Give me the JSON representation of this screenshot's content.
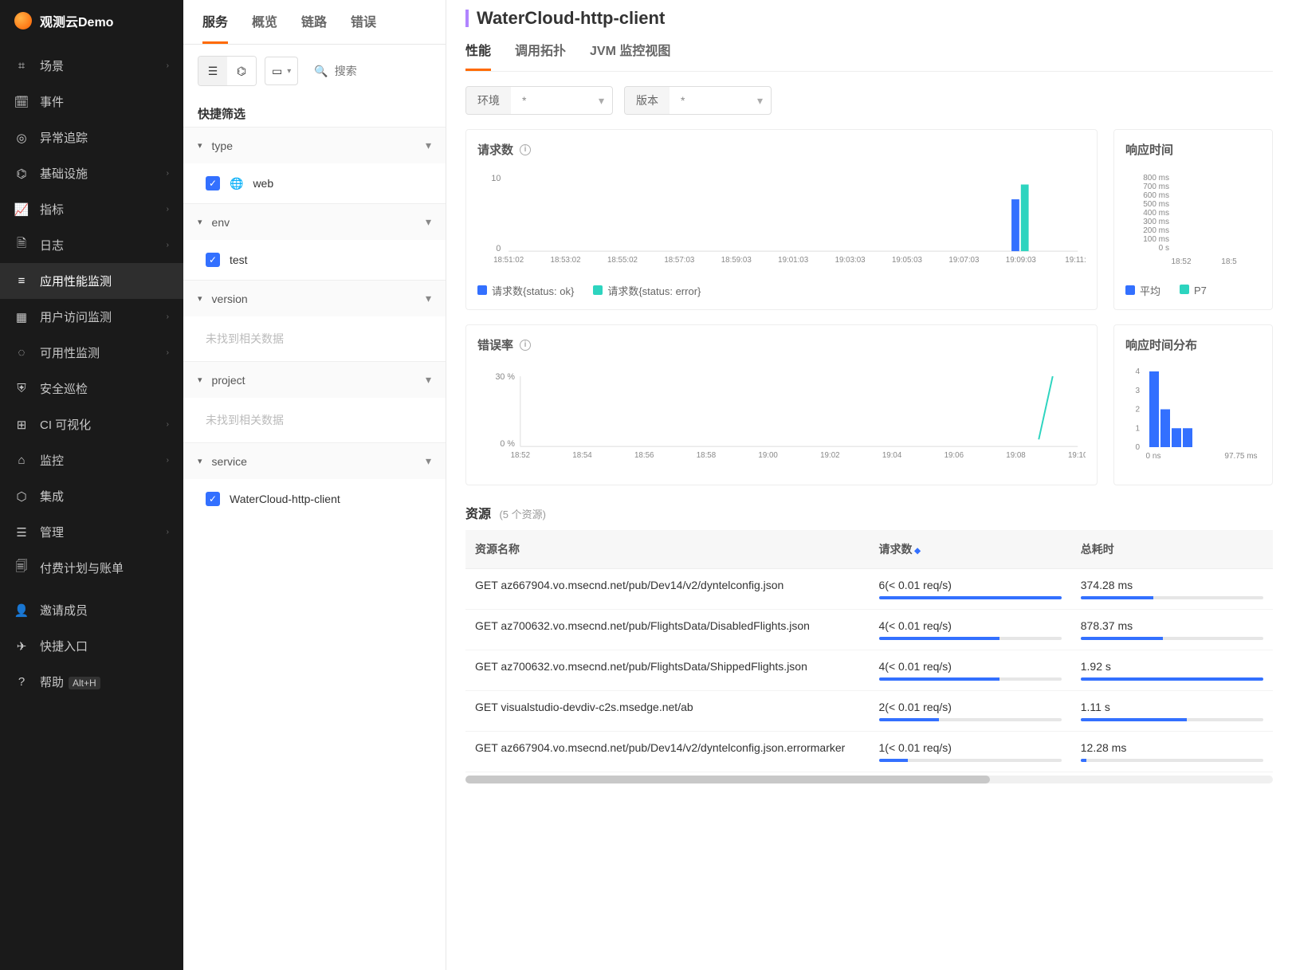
{
  "brand": "观测云Demo",
  "sidebar": {
    "items": [
      {
        "icon": "⌗",
        "label": "场景",
        "chev": true
      },
      {
        "icon": "🗓",
        "label": "事件"
      },
      {
        "icon": "◎",
        "label": "异常追踪"
      },
      {
        "icon": "⌬",
        "label": "基础设施",
        "chev": true
      },
      {
        "icon": "📈",
        "label": "指标",
        "chev": true
      },
      {
        "icon": "🗎",
        "label": "日志",
        "chev": true
      },
      {
        "icon": "≡",
        "label": "应用性能监测",
        "active": true
      },
      {
        "icon": "▦",
        "label": "用户访问监测",
        "chev": true
      },
      {
        "icon": "◌",
        "label": "可用性监测",
        "chev": true
      },
      {
        "icon": "⛨",
        "label": "安全巡检"
      },
      {
        "icon": "⊞",
        "label": "CI 可视化",
        "chev": true
      },
      {
        "icon": "⌂",
        "label": "监控",
        "chev": true
      },
      {
        "icon": "⬡",
        "label": "集成"
      },
      {
        "icon": "☰",
        "label": "管理",
        "chev": true
      },
      {
        "icon": "🗐",
        "label": "付费计划与账单"
      }
    ],
    "bottom": [
      {
        "icon": "👤",
        "label": "邀请成员"
      },
      {
        "icon": "✈",
        "label": "快捷入口"
      },
      {
        "icon": "?",
        "label": "帮助",
        "shortcut": "Alt+H"
      }
    ]
  },
  "topTabs": [
    "服务",
    "概览",
    "链路",
    "错误"
  ],
  "activeTopTab": 0,
  "search": {
    "placeholder": "搜索"
  },
  "filterTitle": "快捷筛选",
  "filterGroups": [
    {
      "name": "type",
      "items": [
        {
          "icon": "🌐",
          "label": "web",
          "checked": true
        }
      ]
    },
    {
      "name": "env",
      "items": [
        {
          "label": "test",
          "checked": true
        }
      ]
    },
    {
      "name": "version",
      "empty": "未找到相关数据"
    },
    {
      "name": "project",
      "empty": "未找到相关数据"
    },
    {
      "name": "service",
      "items": [
        {
          "label": "WaterCloud-http-client",
          "checked": true
        }
      ]
    }
  ],
  "detail": {
    "title": "WaterCloud-http-client",
    "tabs": [
      "性能",
      "调用拓扑",
      "JVM 监控视图"
    ],
    "activeTab": 0,
    "filters": [
      {
        "label": "环境",
        "value": "*"
      },
      {
        "label": "版本",
        "value": "*"
      }
    ]
  },
  "chart_data": [
    {
      "type": "bar",
      "title": "请求数",
      "x_ticks": [
        "18:51:02",
        "18:53:02",
        "18:55:02",
        "18:57:03",
        "18:59:03",
        "19:01:03",
        "19:03:03",
        "19:05:03",
        "19:07:03",
        "19:09:03",
        "19:11:0"
      ],
      "series": [
        {
          "name": "请求数{status: ok}",
          "color": "#3370ff",
          "values": [
            0,
            0,
            0,
            0,
            0,
            0,
            0,
            0,
            0,
            7,
            0
          ]
        },
        {
          "name": "请求数{status: error}",
          "color": "#2dd4bf",
          "values": [
            0,
            0,
            0,
            0,
            0,
            0,
            0,
            0,
            0,
            9,
            0
          ]
        }
      ],
      "y_max": 10,
      "y_ticks": [
        0,
        10
      ]
    },
    {
      "type": "line",
      "title": "响应时间",
      "y_labels": [
        "800 ms",
        "700 ms",
        "600 ms",
        "500 ms",
        "400 ms",
        "300 ms",
        "200 ms",
        "100 ms",
        "0 s"
      ],
      "x_ticks": [
        "18:52",
        "18:5"
      ],
      "series": [
        {
          "name": "平均",
          "color": "#3370ff"
        },
        {
          "name": "P7",
          "color": "#2dd4bf"
        }
      ]
    },
    {
      "type": "line",
      "title": "错误率",
      "x_ticks": [
        "18:52",
        "18:54",
        "18:56",
        "18:58",
        "19:00",
        "19:02",
        "19:04",
        "19:06",
        "19:08",
        "19:10"
      ],
      "y_ticks": [
        "30 %",
        "0 %"
      ],
      "series": [
        {
          "name": "",
          "color": "#2dd4bf",
          "points": [
            [
              0.93,
              0.1
            ],
            [
              0.955,
              1.0
            ]
          ]
        }
      ]
    },
    {
      "type": "bar",
      "title": "响应时间分布",
      "x_ticks": [
        "0 ns",
        "97.75 ms"
      ],
      "y_ticks": [
        0,
        1,
        2,
        3,
        4
      ],
      "values": [
        4,
        2,
        1,
        1,
        0,
        0,
        0,
        0
      ]
    }
  ],
  "resources": {
    "title": "资源",
    "sub": "(5 个资源)",
    "headers": [
      "资源名称",
      "请求数",
      "总耗时"
    ],
    "rows": [
      {
        "name": "GET az667904.vo.msecnd.net/pub/Dev14/v2/dyntelconfig.json",
        "req": "6(< 0.01 req/s)",
        "req_pct": 100,
        "dur": "374.28 ms",
        "dur_pct": 40
      },
      {
        "name": "GET az700632.vo.msecnd.net/pub/FlightsData/DisabledFlights.json",
        "req": "4(< 0.01 req/s)",
        "req_pct": 66,
        "dur": "878.37 ms",
        "dur_pct": 45
      },
      {
        "name": "GET az700632.vo.msecnd.net/pub/FlightsData/ShippedFlights.json",
        "req": "4(< 0.01 req/s)",
        "req_pct": 66,
        "dur": "1.92 s",
        "dur_pct": 100
      },
      {
        "name": "GET visualstudio-devdiv-c2s.msedge.net/ab",
        "req": "2(< 0.01 req/s)",
        "req_pct": 33,
        "dur": "1.11 s",
        "dur_pct": 58
      },
      {
        "name": "GET az667904.vo.msecnd.net/pub/Dev14/v2/dyntelconfig.json.errormarker",
        "req": "1(< 0.01 req/s)",
        "req_pct": 16,
        "dur": "12.28 ms",
        "dur_pct": 3
      }
    ]
  }
}
